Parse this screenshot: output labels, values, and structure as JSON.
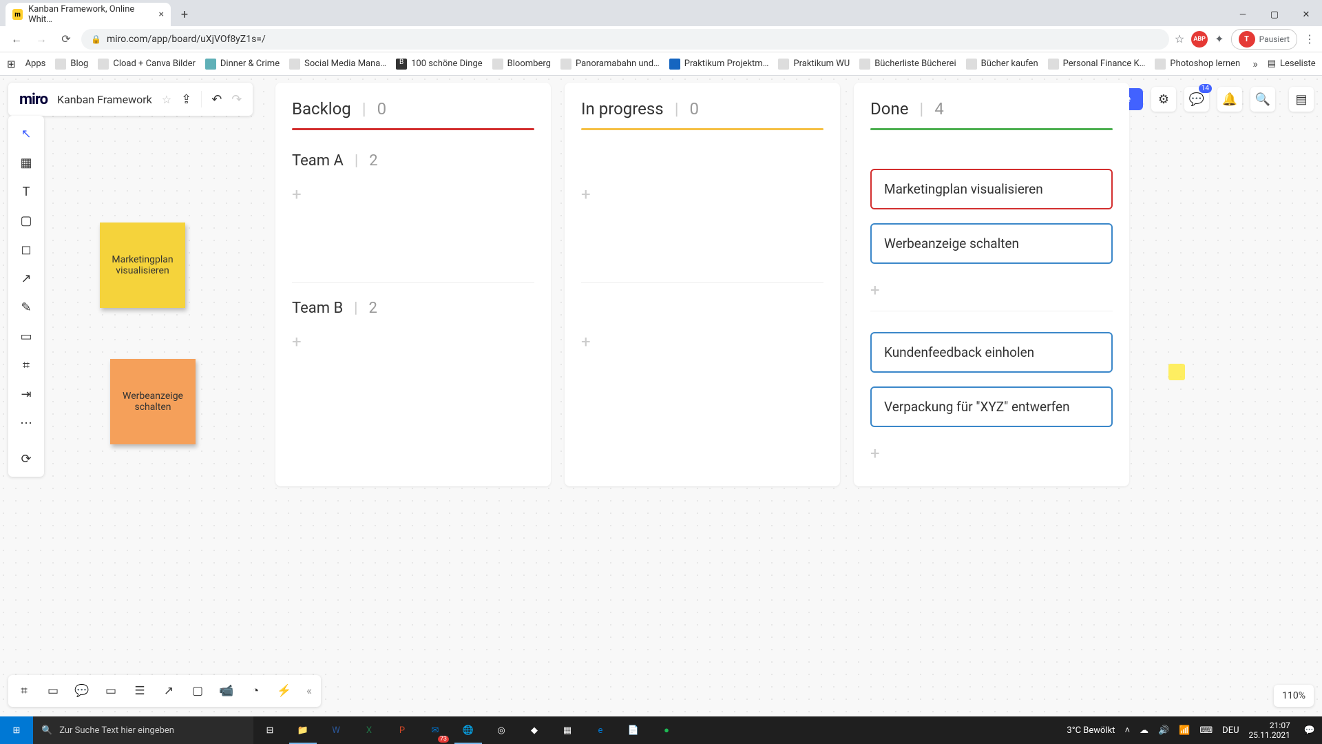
{
  "browser": {
    "tab_title": "Kanban Framework, Online Whit…",
    "url": "miro.com/app/board/uXjVOf8yZ1s=/",
    "profile_label": "Pausiert",
    "reading_list": "Leseliste"
  },
  "bookmarks": [
    "Apps",
    "Blog",
    "Cload + Canva Bilder",
    "Dinner & Crime",
    "Social Media Mana…",
    "100 schöne Dinge",
    "Bloomberg",
    "Panoramabahn und…",
    "Praktikum Projektm…",
    "Praktikum WU",
    "Bücherliste Bücherei",
    "Bücher kaufen",
    "Personal Finance K…",
    "Photoshop lernen"
  ],
  "miro": {
    "logo": "miro",
    "board_name": "Kanban Framework",
    "share": "Share",
    "zoom": "110%",
    "notif_count": "14"
  },
  "stickies": {
    "yellow": "Marketingplan visualisieren",
    "orange": "Werbeanzeige schalten"
  },
  "kanban": {
    "columns": [
      {
        "title": "Backlog",
        "count": "0",
        "color": "red"
      },
      {
        "title": "In progress",
        "count": "0",
        "color": "yellow"
      },
      {
        "title": "Done",
        "count": "4",
        "color": "green"
      }
    ],
    "swimlanes": [
      {
        "name": "Team A",
        "count": "2"
      },
      {
        "name": "Team B",
        "count": "2"
      }
    ],
    "done_cards_a": [
      {
        "text": "Marketingplan visualisieren",
        "color": "red"
      },
      {
        "text": "Werbeanzeige schalten",
        "color": "blue"
      }
    ],
    "done_cards_b": [
      {
        "text": "Kundenfeedback einholen",
        "color": "blue"
      },
      {
        "text": "Verpackung für \"XYZ\" entwerfen",
        "color": "blue"
      }
    ]
  },
  "taskbar": {
    "search_placeholder": "Zur Suche Text hier eingeben",
    "weather": "3°C  Bewölkt",
    "lang": "DEU",
    "time": "21:07",
    "date": "25.11.2021",
    "mail_badge": "73"
  }
}
